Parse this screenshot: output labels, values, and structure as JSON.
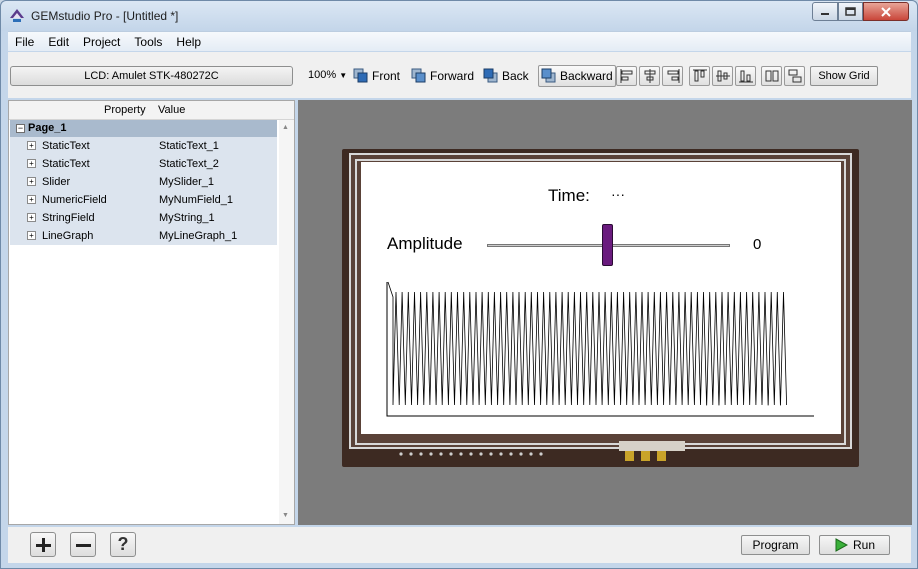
{
  "window": {
    "title": "GEMstudio Pro - [Untitled *]"
  },
  "menu": [
    "File",
    "Edit",
    "Project",
    "Tools",
    "Help"
  ],
  "toolbar": {
    "lcd_label": "LCD: Amulet STK-480272C",
    "zoom": "100%",
    "front": "Front",
    "forward": "Forward",
    "back": "Back",
    "backward": "Backward",
    "show_grid": "Show Grid"
  },
  "properties": {
    "header_property": "Property",
    "header_value": "Value",
    "page": "Page_1",
    "rows": [
      {
        "property": "StaticText",
        "value": "StaticText_1"
      },
      {
        "property": "StaticText",
        "value": "StaticText_2"
      },
      {
        "property": "Slider",
        "value": "MySlider_1"
      },
      {
        "property": "NumericField",
        "value": "MyNumField_1"
      },
      {
        "property": "StringField",
        "value": "MyString_1"
      },
      {
        "property": "LineGraph",
        "value": "MyLineGraph_1"
      }
    ]
  },
  "screen": {
    "time_label": "Time:",
    "time_value": "···",
    "amplitude_label": "Amplitude",
    "amplitude_value": "0",
    "slider_level": 0.5
  },
  "bottom": {
    "program": "Program",
    "run": "Run",
    "help_glyph": "?"
  }
}
